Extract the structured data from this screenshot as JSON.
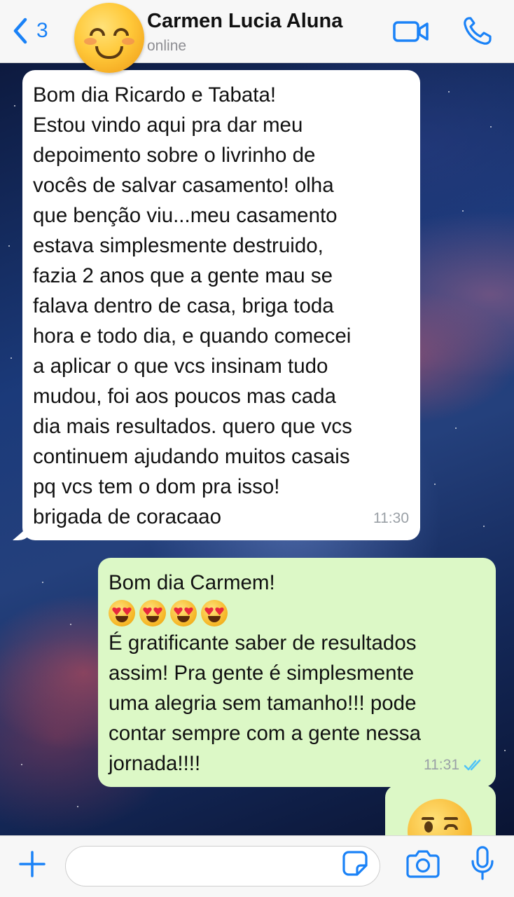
{
  "header": {
    "back_count": "3",
    "contact_name": "Carmen Lucia Aluna",
    "status": "online"
  },
  "messages": [
    {
      "direction": "incoming",
      "lines": [
        "Bom dia Ricardo e Tabata!",
        "Estou vindo aqui pra dar meu",
        "depoimento sobre o livrinho de",
        "vocês de salvar casamento! olha",
        "que benção viu...meu casamento",
        "estava simplesmente destruido,",
        "fazia 2 anos que a gente mau se",
        "falava dentro de casa, briga toda",
        "hora e todo dia, e quando comecei",
        "a aplicar o que vcs insinam tudo",
        "mudou, foi aos poucos mas cada",
        "dia mais resultados. quero que vcs",
        "continuem ajudando muitos casais",
        "pq vcs tem o dom pra isso!",
        "brigada de coracaao"
      ],
      "time": "11:30"
    },
    {
      "direction": "outgoing",
      "lines_before_emoji": [
        "Bom dia Carmem!"
      ],
      "emoji": [
        "heart-eyes",
        "heart-eyes",
        "heart-eyes",
        "heart-eyes"
      ],
      "lines_after_emoji": [
        "É gratificante saber de resultados",
        "assim! Pra gente é simplesmente",
        "uma alegria sem tamanho!!! pode",
        "contar sempre com a gente nessa",
        "jornada!!!!"
      ],
      "time": "11:31",
      "status": "read"
    },
    {
      "direction": "outgoing",
      "emoji": "winking-face"
    }
  ],
  "colors": {
    "accent": "#1a82f7",
    "incoming_bubble": "#ffffff",
    "outgoing_bubble": "#dcf8c6",
    "read_ticks": "#4fc3f7"
  }
}
